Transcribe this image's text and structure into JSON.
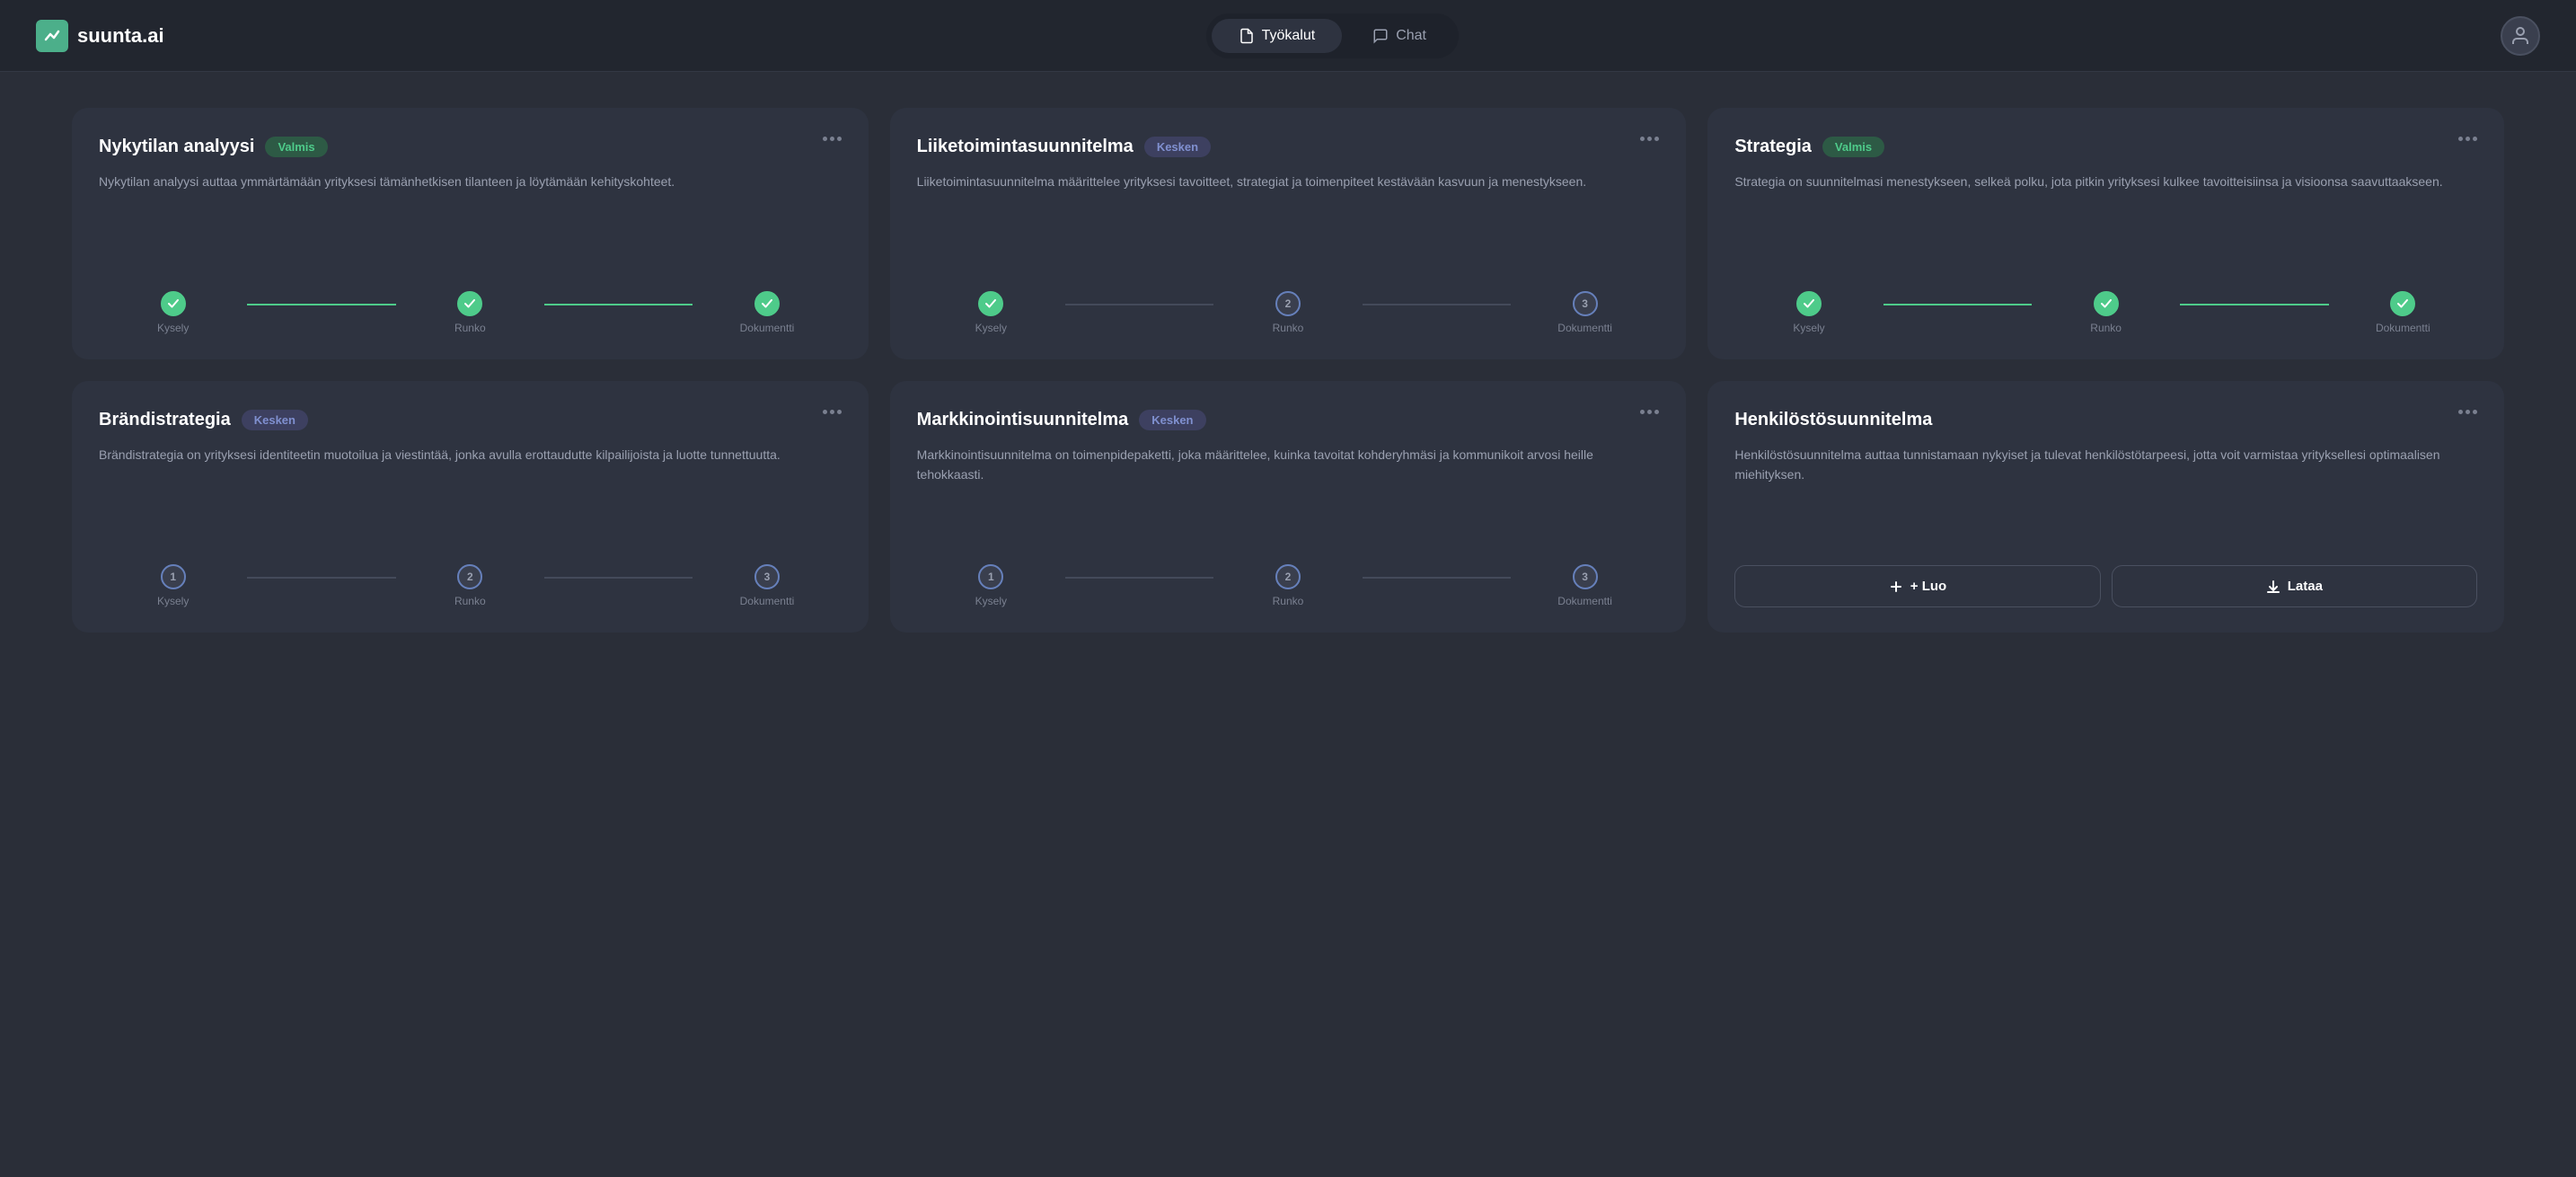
{
  "header": {
    "logo_text": "suunta.ai",
    "nav": [
      {
        "id": "tyokalut",
        "label": "Työkalut",
        "icon": "document-icon",
        "active": true
      },
      {
        "id": "chat",
        "label": "Chat",
        "icon": "chat-icon",
        "active": false
      }
    ],
    "user_icon": "user-icon"
  },
  "cards": [
    {
      "id": "nykytilan-analyysi",
      "title": "Nykytilan analyysi",
      "badge": "Valmis",
      "badge_type": "valmis",
      "desc": "Nykytilan analyysi auttaa ymmärtämään yrityksesi tämänhetkisen tilanteen ja löytämään kehityskohteet.",
      "steps": [
        {
          "label": "Kysely",
          "state": "done"
        },
        {
          "label": "Runko",
          "state": "done"
        },
        {
          "label": "Dokumentti",
          "state": "done"
        }
      ],
      "actions": null
    },
    {
      "id": "liiketoimintasuunnitelma",
      "title": "Liiketoimintasuunnitelma",
      "badge": "Kesken",
      "badge_type": "kesken",
      "desc": "Liiketoimintasuunnitelma määrittelee yrityksesi tavoitteet, strategiat ja toimenpiteet kestävään kasvuun ja menestykseen.",
      "steps": [
        {
          "label": "Kysely",
          "state": "done"
        },
        {
          "label": "Runko",
          "state": "number",
          "num": "2"
        },
        {
          "label": "Dokumentti",
          "state": "number",
          "num": "3"
        }
      ],
      "actions": null
    },
    {
      "id": "strategia",
      "title": "Strategia",
      "badge": "Valmis",
      "badge_type": "valmis",
      "desc": "Strategia on suunnitelmasi menestykseen, selkeä polku, jota pitkin yrityksesi kulkee tavoitteisiinsa ja visioonsa saavuttaakseen.",
      "steps": [
        {
          "label": "Kysely",
          "state": "done"
        },
        {
          "label": "Runko",
          "state": "done"
        },
        {
          "label": "Dokumentti",
          "state": "done"
        }
      ],
      "actions": null
    },
    {
      "id": "brandistrategia",
      "title": "Brändistrategia",
      "badge": "Kesken",
      "badge_type": "kesken",
      "desc": "Brändistrategia on yrityksesi identiteetin muotoilua ja viestintää, jonka avulla erottaudutte kilpailijoista ja luotte tunnettuutta.",
      "steps": [
        {
          "label": "Kysely",
          "state": "number",
          "num": "1"
        },
        {
          "label": "Runko",
          "state": "number",
          "num": "2"
        },
        {
          "label": "Dokumentti",
          "state": "number",
          "num": "3"
        }
      ],
      "actions": null
    },
    {
      "id": "markkinointisuunnitelma",
      "title": "Markkinointisuunnitelma",
      "badge": "Kesken",
      "badge_type": "kesken",
      "desc": "Markkinointisuunnitelma on toimenpidepaketti, joka määrittelee, kuinka tavoitat kohderyhmäsi ja kommunikoit arvosi heille tehokkaasti.",
      "steps": [
        {
          "label": "Kysely",
          "state": "number",
          "num": "1"
        },
        {
          "label": "Runko",
          "state": "number",
          "num": "2"
        },
        {
          "label": "Dokumentti",
          "state": "number",
          "num": "3"
        }
      ],
      "actions": null
    },
    {
      "id": "henkilostosuunnitelma",
      "title": "Henkilöstösuunnitelma",
      "badge": null,
      "badge_type": null,
      "desc": "Henkilöstösuunnitelma auttaa tunnistamaan nykyiset ja tulevat henkilöstötarpeesi, jotta voit varmistaa yrityksellesi optimaalisen miehityksen.",
      "steps": null,
      "actions": [
        {
          "id": "create",
          "label": "+ Luo",
          "icon": "plus-icon"
        },
        {
          "id": "download",
          "label": "Lataa",
          "icon": "download-icon"
        }
      ]
    }
  ],
  "icons": {
    "document": "📄",
    "chat": "💬",
    "checkmark": "✓",
    "plus": "+",
    "download": "⬇",
    "user": "👤",
    "more": "•••"
  }
}
